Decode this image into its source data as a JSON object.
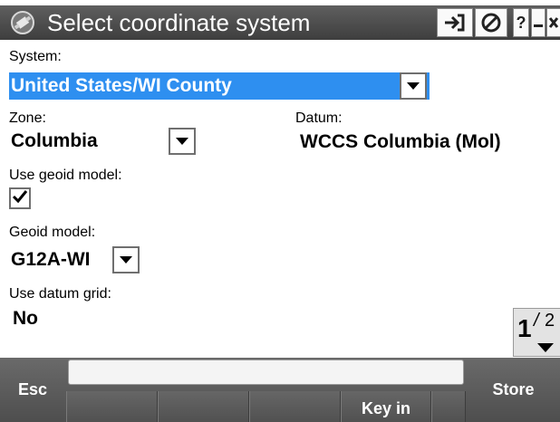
{
  "window": {
    "title": "Select coordinate system",
    "icons": [
      "app-satellite-icon",
      "login-arrow-icon",
      "no-entry-icon",
      "help-icon",
      "minimize-icon",
      "close-icon"
    ],
    "help_label": "?"
  },
  "system": {
    "label": "System:",
    "value": "United States/WI County"
  },
  "zone": {
    "label": "Zone:",
    "value": "Columbia"
  },
  "datum": {
    "label": "Datum:",
    "value": "WCCS Columbia (Mol)"
  },
  "use_geoid": {
    "label": "Use geoid model:",
    "checked": true
  },
  "geoid_model": {
    "label": "Geoid model:",
    "value": "G12A-WI"
  },
  "use_datum_grid": {
    "label": "Use datum grid:",
    "value": "No"
  },
  "page_indicator": {
    "current": "1",
    "separator": "/",
    "total": "2"
  },
  "softkeys": {
    "esc": "Esc",
    "store": "Store",
    "key_in": "Key in"
  },
  "colors": {
    "selection": "#2e8ff0",
    "titlebar": "#4a4a4a",
    "softkey_bar": "#5a5a5a"
  }
}
